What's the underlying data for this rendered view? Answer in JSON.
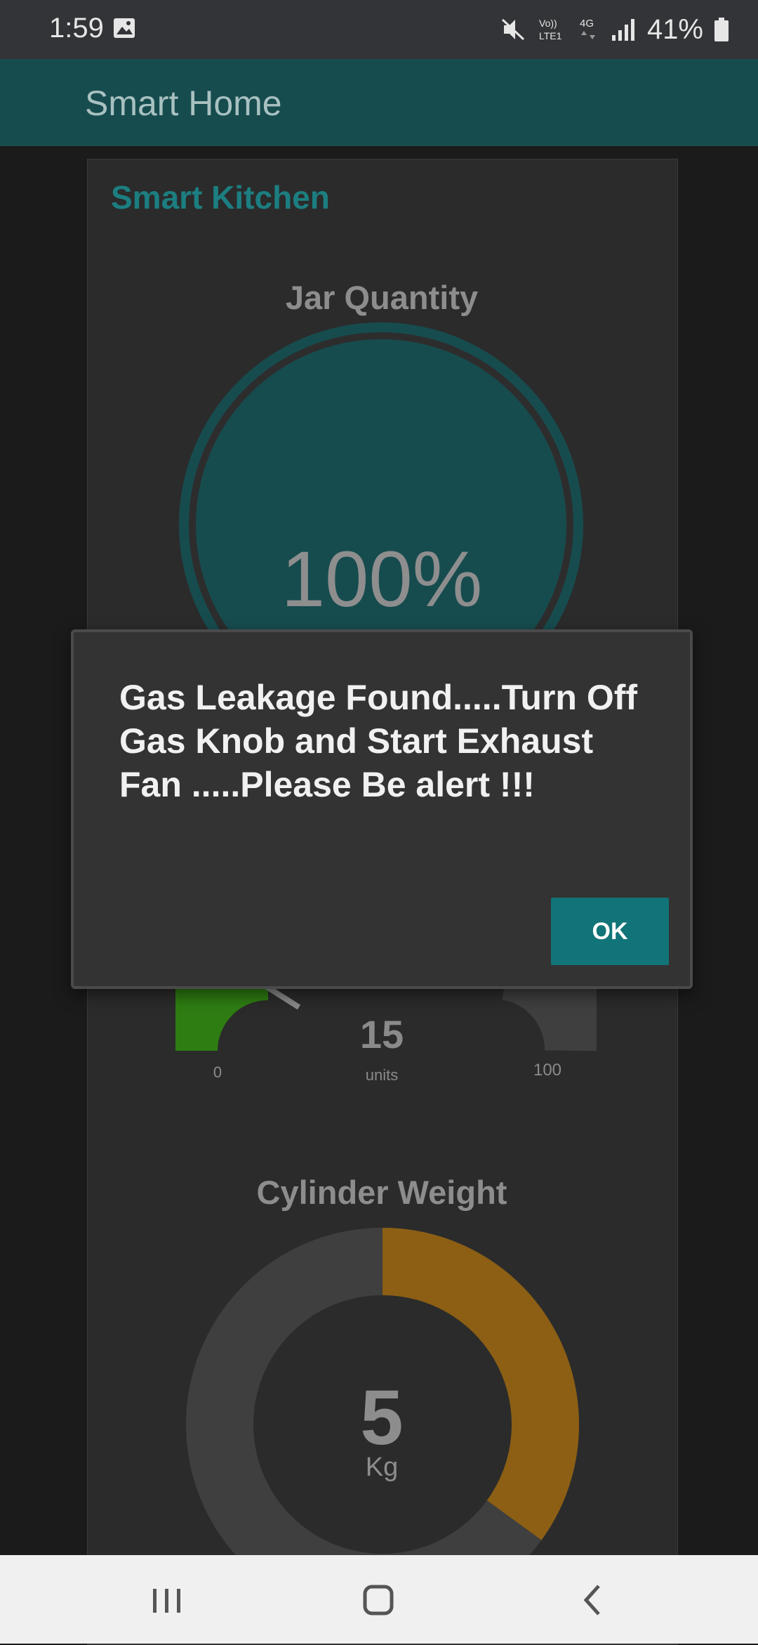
{
  "status_bar": {
    "time": "1:59",
    "battery_percent": "41%",
    "icons": [
      "image-icon",
      "mute-icon",
      "volte-icon",
      "4g-icon",
      "signal-icon",
      "battery-icon"
    ]
  },
  "app_bar": {
    "title": "Smart Home"
  },
  "card": {
    "title": "Smart Kitchen",
    "jar": {
      "title": "Jar Quantity",
      "value": "100%",
      "fill_fraction": 1.0
    },
    "gas_gauge": {
      "value": "15",
      "units": "units",
      "min": "0",
      "max": "100",
      "fraction": 0.15
    },
    "cylinder": {
      "title": "Cylinder Weight",
      "value": "5",
      "unit": "Kg",
      "fill_fraction": 0.35
    }
  },
  "dialog": {
    "message": "Gas Leakage Found.....Turn Off Gas Knob and Start Exhaust Fan .....Please Be alert !!!",
    "ok_label": "OK"
  },
  "colors": {
    "accent": "#117478",
    "app_bar": "#174c4f",
    "jar_fill": "#174c4f",
    "gauge_green": "#2e7d12",
    "cylinder_orange": "#8c5f14"
  },
  "nav_bar": {
    "icons": [
      "recents-icon",
      "home-icon",
      "back-icon"
    ]
  }
}
